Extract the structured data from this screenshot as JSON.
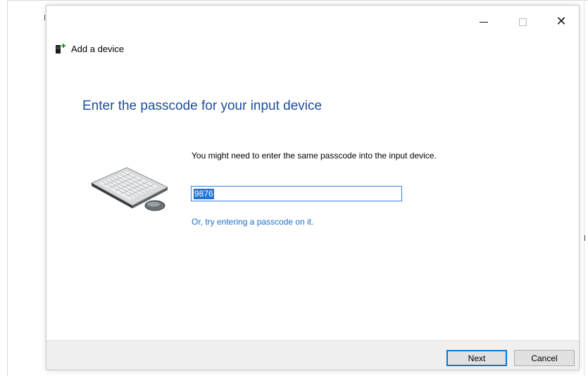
{
  "window": {
    "title": "Add a device",
    "controls": {
      "minimize": "minimize",
      "maximize": "maximize",
      "close": "close"
    }
  },
  "main": {
    "heading": "Enter the passcode for your input device",
    "instruction": "You might need to enter the same passcode into the input device.",
    "passcode_value": "9876",
    "alt_link": "Or, try entering a passcode on it.",
    "illustration": "keyboard-and-mouse-image"
  },
  "footer": {
    "next_label": "Next",
    "cancel_label": "Cancel"
  },
  "colors": {
    "heading": "#1f4e9c",
    "link": "#1f6ec8",
    "selection": "#1e73d8",
    "focus_border": "#0078d7",
    "footer_bg": "#f0f0f0"
  },
  "icons": {
    "header": "add-device-icon",
    "close": "close-icon",
    "minimize": "minimize-icon",
    "maximize": "maximize-icon"
  }
}
